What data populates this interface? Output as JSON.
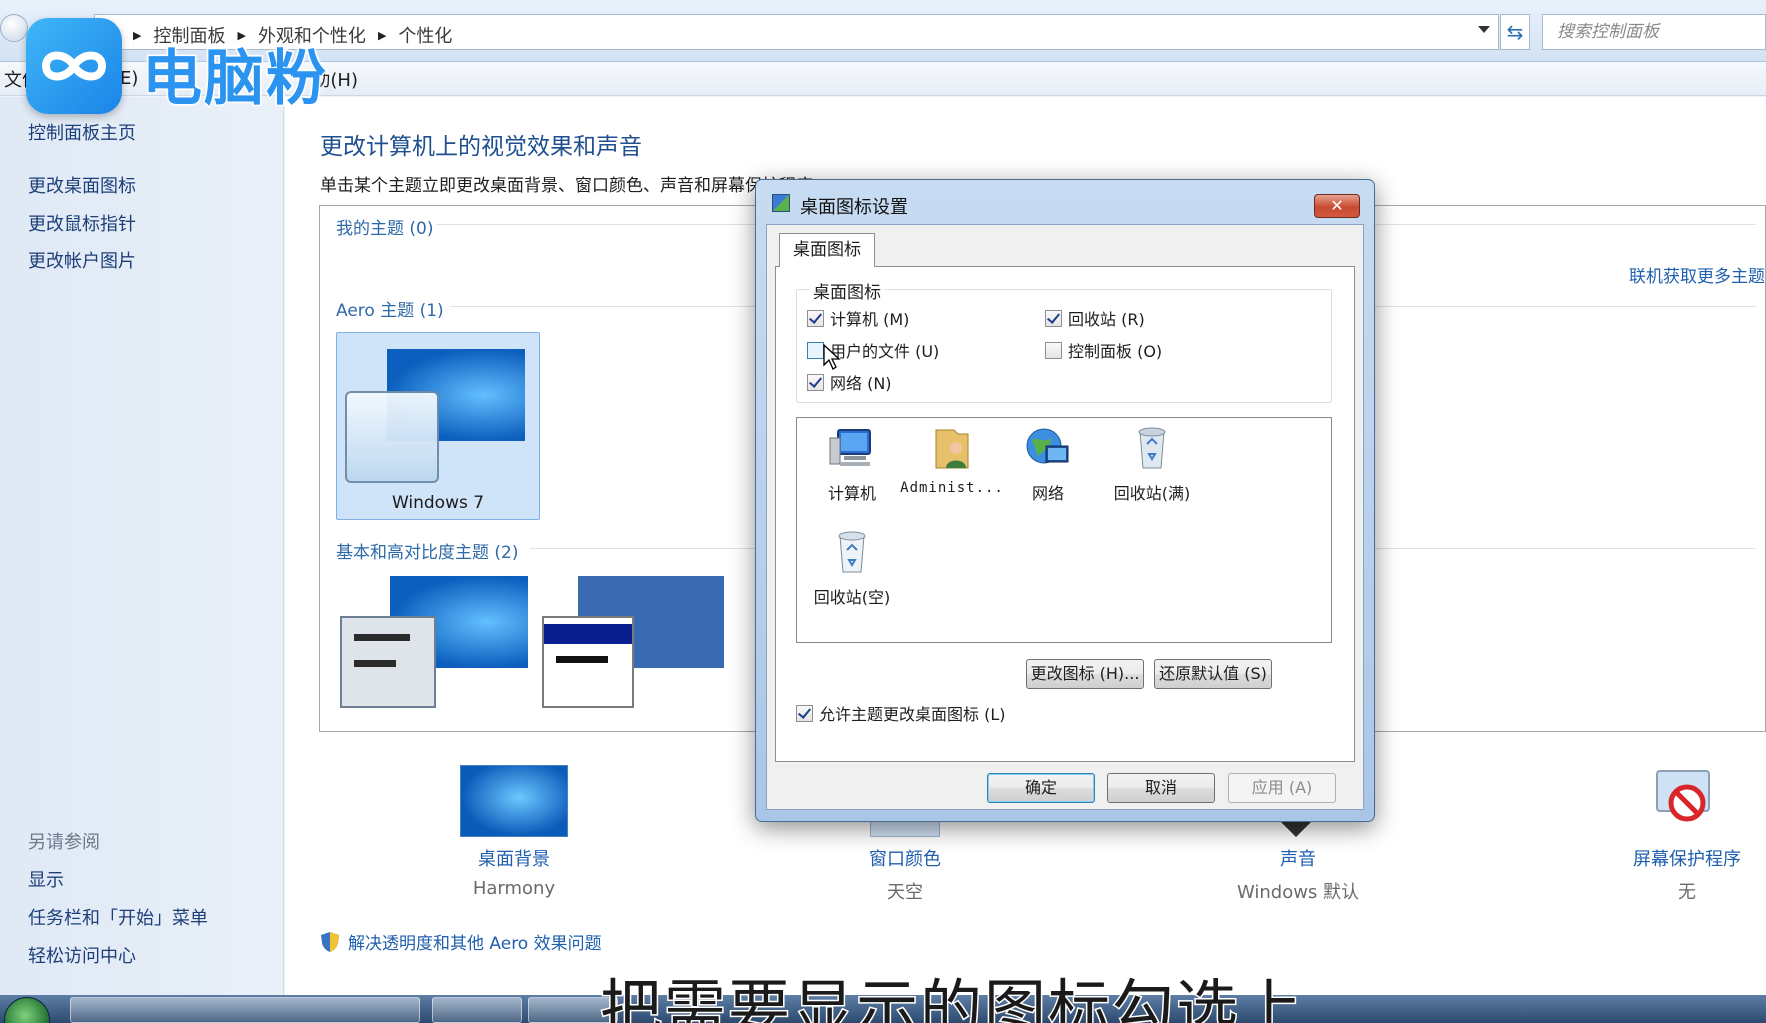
{
  "address_bar": {
    "breadcrumbs": [
      "控制面板",
      "外观和个性化",
      "个性化"
    ],
    "search_placeholder": "搜索控制面板"
  },
  "menu": {
    "items": [
      "文件",
      "E)",
      "助(H)"
    ]
  },
  "watermark": {
    "text": "电脑粉"
  },
  "left_pane": {
    "home": "控制面板主页",
    "links": [
      "更改桌面图标",
      "更改鼠标指针",
      "更改帐户图片"
    ],
    "see_also_header": "另请参阅",
    "see_also": [
      "显示",
      "任务栏和「开始」菜单",
      "轻松访问中心"
    ]
  },
  "main": {
    "title": "更改计算机上的视觉效果和声音",
    "description": "单击某个主题立即更改桌面背景、窗口颜色、声音和屏幕保护程序",
    "my_themes": "我的主题 (0)",
    "online_link": "联机获取更多主题",
    "aero_themes": "Aero 主题 (1)",
    "aero_theme_name": "Windows 7",
    "basic_themes": "基本和高对比度主题 (2)",
    "bottom_items": [
      {
        "title": "桌面背景",
        "subtitle": "Harmony"
      },
      {
        "title": "窗口颜色",
        "subtitle": "天空"
      },
      {
        "title": "声音",
        "subtitle": "Windows 默认"
      },
      {
        "title": "屏幕保护程序",
        "subtitle": "无"
      }
    ],
    "troubleshoot_link": "解决透明度和其他 Aero 效果问题"
  },
  "dialog": {
    "title": "桌面图标设置",
    "close": "✕",
    "tab": "桌面图标",
    "group_label": "桌面图标",
    "checkboxes": [
      {
        "label": "计算机 (M)",
        "checked": true
      },
      {
        "label": "回收站 (R)",
        "checked": true
      },
      {
        "label": "用户的文件 (U)",
        "checked": false
      },
      {
        "label": "控制面板 (O)",
        "checked": false
      },
      {
        "label": "网络 (N)",
        "checked": true
      }
    ],
    "icons": [
      "计算机",
      "Administ...",
      "网络",
      "回收站(满)",
      "回收站(空)"
    ],
    "change_icon_button": "更改图标 (H)...",
    "restore_default_button": "还原默认值 (S)",
    "allow_themes_label": "允许主题更改桌面图标 (L)",
    "allow_themes_checked": true,
    "ok_button": "确定",
    "cancel_button": "取消",
    "apply_button": "应用 (A)"
  },
  "caption": "把需要显示的图标勾选上"
}
